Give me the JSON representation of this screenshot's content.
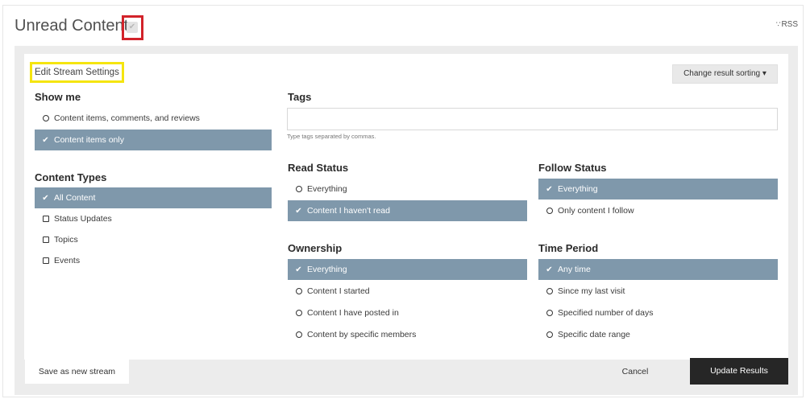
{
  "header": {
    "title": "Unread Content",
    "rss_label": "RSS",
    "rss_icon": "rss-icon"
  },
  "toolbar": {
    "edit_stream_label": "Edit Stream Settings",
    "sort_label": "Change result sorting ▾"
  },
  "show_me": {
    "heading": "Show me",
    "options": [
      {
        "label": "Content items, comments, and reviews",
        "selected": false
      },
      {
        "label": "Content items only",
        "selected": true
      }
    ]
  },
  "content_types": {
    "heading": "Content Types",
    "options": [
      {
        "label": "All Content",
        "selected": true
      },
      {
        "label": "Status Updates",
        "selected": false
      },
      {
        "label": "Topics",
        "selected": false
      },
      {
        "label": "Events",
        "selected": false
      }
    ]
  },
  "tags": {
    "heading": "Tags",
    "value": "",
    "hint": "Type tags separated by commas."
  },
  "read_status": {
    "heading": "Read Status",
    "options": [
      {
        "label": "Everything",
        "selected": false
      },
      {
        "label": "Content I haven't read",
        "selected": true
      }
    ]
  },
  "follow_status": {
    "heading": "Follow Status",
    "options": [
      {
        "label": "Everything",
        "selected": true
      },
      {
        "label": "Only content I follow",
        "selected": false
      }
    ]
  },
  "ownership": {
    "heading": "Ownership",
    "options": [
      {
        "label": "Everything",
        "selected": true
      },
      {
        "label": "Content I started",
        "selected": false
      },
      {
        "label": "Content I have posted in",
        "selected": false
      },
      {
        "label": "Content by specific members",
        "selected": false
      }
    ]
  },
  "time_period": {
    "heading": "Time Period",
    "options": [
      {
        "label": "Any time",
        "selected": true
      },
      {
        "label": "Since my last visit",
        "selected": false
      },
      {
        "label": "Specified number of days",
        "selected": false
      },
      {
        "label": "Specific date range",
        "selected": false
      }
    ]
  },
  "footer": {
    "save_label": "Save as new stream",
    "cancel_label": "Cancel",
    "update_label": "Update Results"
  },
  "colors": {
    "selected_bg": "#7f98ab",
    "title_marker": "#d2232a",
    "edit_marker": "#f5e50f",
    "primary_button": "#262626"
  }
}
